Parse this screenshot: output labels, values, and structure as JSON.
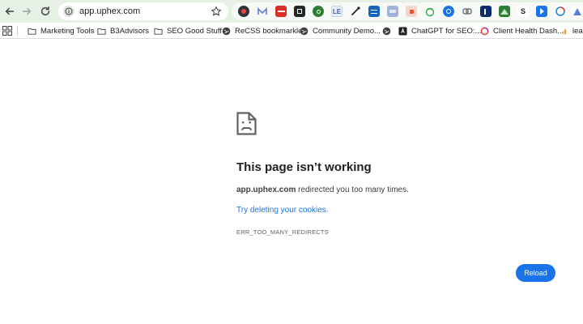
{
  "toolbar": {
    "url": "app.uphex.com",
    "back_icon": "back-arrow-icon",
    "forward_icon": "forward-arrow-icon",
    "reload_icon": "reload-icon",
    "bookmark_icon": "star-icon",
    "extension_texts": [
      "LE",
      "S"
    ]
  },
  "bookmarks": {
    "items": [
      {
        "label": "Marketing Tools",
        "icon": "folder-icon"
      },
      {
        "label": "B3Advisors",
        "icon": "folder-icon"
      },
      {
        "label": "SEO Good Stuff",
        "icon": "folder-icon"
      },
      {
        "label": "ReCSS bookmarkle",
        "icon": "globe-icon"
      },
      {
        "label": "Community Demo...",
        "icon": "globe-icon"
      },
      {
        "label": "",
        "icon": "globe-icon"
      },
      {
        "label": "ChatGPT for SEO:...",
        "icon": "chatgpt-icon"
      },
      {
        "label": "Client Health Dash...",
        "icon": "dashboard-icon"
      },
      {
        "label": "lear",
        "icon": "bar-chart-icon"
      }
    ]
  },
  "error": {
    "title": "This page isn’t working",
    "host": "app.uphex.com",
    "message": " redirected you too many times.",
    "link": "Try deleting your cookies.",
    "code": "ERR_TOO_MANY_REDIRECTS",
    "reload_label": "Reload"
  },
  "colors": {
    "toolbar_bg": "#e6f0e4",
    "accent": "#1a73e8",
    "text": "#202124"
  }
}
